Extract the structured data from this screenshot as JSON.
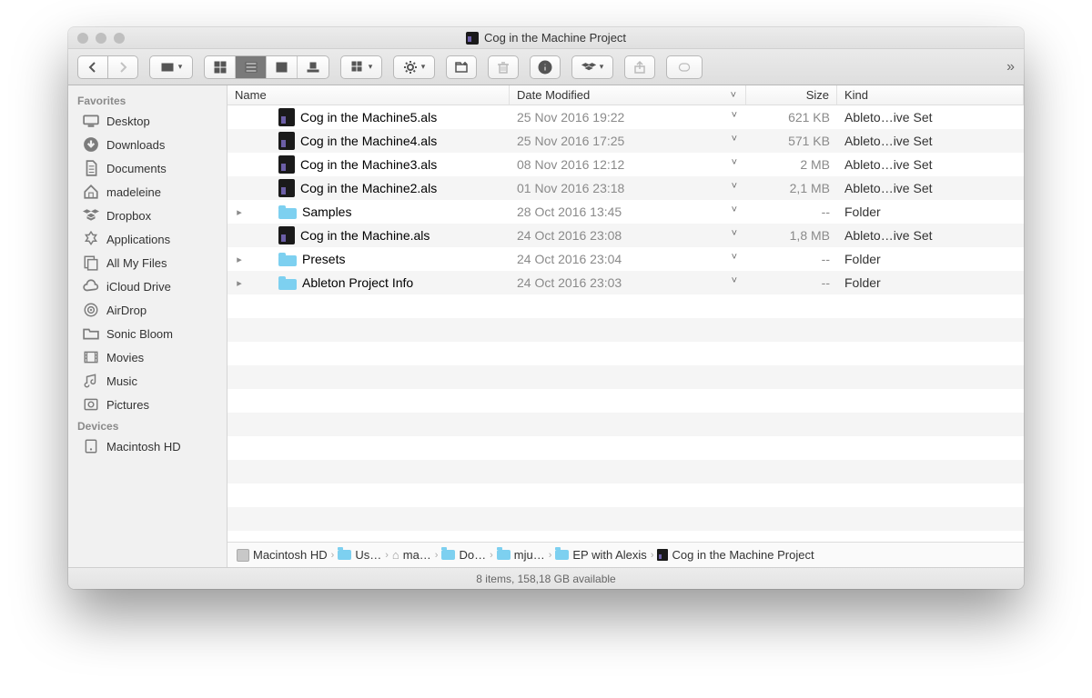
{
  "window": {
    "title": "Cog in the Machine Project"
  },
  "sidebar": {
    "sections": {
      "favorites_label": "Favorites",
      "devices_label": "Devices"
    },
    "favorites": [
      {
        "label": "Desktop",
        "icon": "desktop"
      },
      {
        "label": "Downloads",
        "icon": "downloads"
      },
      {
        "label": "Documents",
        "icon": "documents"
      },
      {
        "label": "madeleine",
        "icon": "home"
      },
      {
        "label": "Dropbox",
        "icon": "dropbox"
      },
      {
        "label": "Applications",
        "icon": "apps"
      },
      {
        "label": "All My Files",
        "icon": "allfiles"
      },
      {
        "label": "iCloud Drive",
        "icon": "icloud"
      },
      {
        "label": "AirDrop",
        "icon": "airdrop"
      },
      {
        "label": "Sonic Bloom",
        "icon": "folder"
      },
      {
        "label": "Movies",
        "icon": "movies"
      },
      {
        "label": "Music",
        "icon": "music"
      },
      {
        "label": "Pictures",
        "icon": "pictures"
      }
    ],
    "devices": [
      {
        "label": "Macintosh HD",
        "icon": "disk"
      }
    ]
  },
  "columns": {
    "name": "Name",
    "date": "Date Modified",
    "size": "Size",
    "kind": "Kind"
  },
  "files": [
    {
      "type": "als",
      "expandable": false,
      "name": "Cog in the Machine5.als",
      "date": "25 Nov 2016 19:22",
      "size": "621 KB",
      "kind": "Ableto…ive Set"
    },
    {
      "type": "als",
      "expandable": false,
      "name": "Cog in the Machine4.als",
      "date": "25 Nov 2016 17:25",
      "size": "571 KB",
      "kind": "Ableto…ive Set"
    },
    {
      "type": "als",
      "expandable": false,
      "name": "Cog in the Machine3.als",
      "date": "08 Nov 2016 12:12",
      "size": "2 MB",
      "kind": "Ableto…ive Set"
    },
    {
      "type": "als",
      "expandable": false,
      "name": "Cog in the Machine2.als",
      "date": "01 Nov 2016 23:18",
      "size": "2,1 MB",
      "kind": "Ableto…ive Set"
    },
    {
      "type": "folder",
      "expandable": true,
      "name": "Samples",
      "date": "28 Oct 2016 13:45",
      "size": "--",
      "kind": "Folder"
    },
    {
      "type": "als",
      "expandable": false,
      "name": "Cog in the Machine.als",
      "date": "24 Oct 2016 23:08",
      "size": "1,8 MB",
      "kind": "Ableto…ive Set"
    },
    {
      "type": "folder",
      "expandable": true,
      "name": "Presets",
      "date": "24 Oct 2016 23:04",
      "size": "--",
      "kind": "Folder"
    },
    {
      "type": "folder",
      "expandable": true,
      "name": "Ableton Project Info",
      "date": "24 Oct 2016 23:03",
      "size": "--",
      "kind": "Folder"
    }
  ],
  "pathbar": [
    {
      "icon": "disk",
      "label": "Macintosh HD"
    },
    {
      "icon": "folder",
      "label": "Us…"
    },
    {
      "icon": "home",
      "label": "ma…"
    },
    {
      "icon": "folder",
      "label": "Do…"
    },
    {
      "icon": "folder",
      "label": "mju…"
    },
    {
      "icon": "folder",
      "label": "EP with Alexis"
    },
    {
      "icon": "als",
      "label": "Cog in the Machine Project"
    }
  ],
  "status": "8 items, 158,18 GB available"
}
